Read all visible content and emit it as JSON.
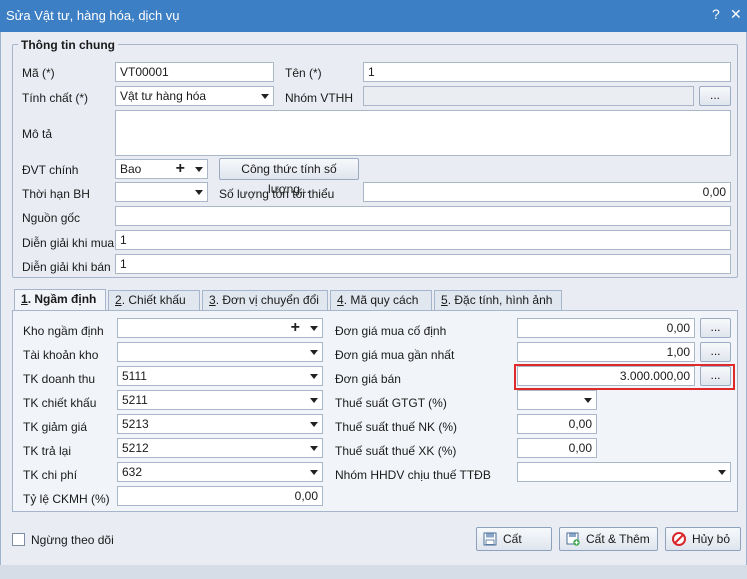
{
  "window": {
    "title": "Sửa Vật tư, hàng hóa, dịch vụ",
    "help_glyph": "?",
    "close_glyph": "✕"
  },
  "general": {
    "group_title": "Thông tin chung",
    "code_label": "Mã (*)",
    "code_value": "VT00001",
    "name_label": "Tên (*)",
    "name_value": "1",
    "nature_label": "Tính chất (*)",
    "nature_value": "Vật tư hàng hóa",
    "group_label": "Nhóm VTHH",
    "group_value": "",
    "desc_label": "Mô tả",
    "desc_value": "",
    "unit_label": "ĐVT chính",
    "unit_value": "Bao",
    "formula_button": "Công thức tính số lượng...",
    "warranty_label": "Thời hạn BH",
    "warranty_value": "",
    "min_stock_label": "Số lượng tồn tối thiểu",
    "min_stock_value": "0,00",
    "origin_label": "Nguồn gốc",
    "origin_value": "",
    "buy_desc_label": "Diễn giải khi mua",
    "buy_desc_value": "1",
    "sell_desc_label": "Diễn giải khi bán",
    "sell_desc_value": "1",
    "ellipsis": "..."
  },
  "tabs": [
    {
      "num": "1",
      "label": ". Ngầm định"
    },
    {
      "num": "2",
      "label": ". Chiết khấu"
    },
    {
      "num": "3",
      "label": ". Đơn vị chuyển đổi"
    },
    {
      "num": "4",
      "label": ". Mã quy cách"
    },
    {
      "num": "5",
      "label": ". Đặc tính, hình ảnh"
    }
  ],
  "defaults": {
    "warehouse_label": "Kho ngầm định",
    "warehouse_value": "",
    "stock_account_label": "Tài khoản kho",
    "stock_account_value": "",
    "revenue_account_label": "TK doanh thu",
    "revenue_account_value": "5111",
    "discount_account_label": "TK chiết khấu",
    "discount_account_value": "5211",
    "reduction_account_label": "TK giảm giá",
    "reduction_account_value": "5213",
    "return_account_label": "TK trả lại",
    "return_account_value": "5212",
    "expense_account_label": "TK chi phí",
    "expense_account_value": "632",
    "ckmh_rate_label": "Tỷ lệ CKMH (%)",
    "ckmh_rate_value": "0,00",
    "fixed_price_label": "Đơn giá mua cố định",
    "fixed_price_value": "0,00",
    "last_price_label": "Đơn giá mua gần nhất",
    "last_price_value": "1,00",
    "sell_price_label": "Đơn giá bán",
    "sell_price_value": "3.000.000,00",
    "vat_label": "Thuế suất GTGT (%)",
    "vat_value": "",
    "import_tax_label": "Thuế suất thuế NK (%)",
    "import_tax_value": "0,00",
    "export_tax_label": "Thuế suất thuế XK (%)",
    "export_tax_value": "0,00",
    "ttdb_group_label": "Nhóm HHDV chịu thuế TTĐB",
    "ttdb_group_value": ""
  },
  "footer": {
    "inactive_label": "Ngừng theo dõi",
    "save_label": "Cất",
    "save_add_label": "Cất & Thêm",
    "cancel_label": "Hủy bỏ"
  },
  "colors": {
    "title_bar": "#3c7fc4",
    "highlight": "#e02a2a"
  }
}
